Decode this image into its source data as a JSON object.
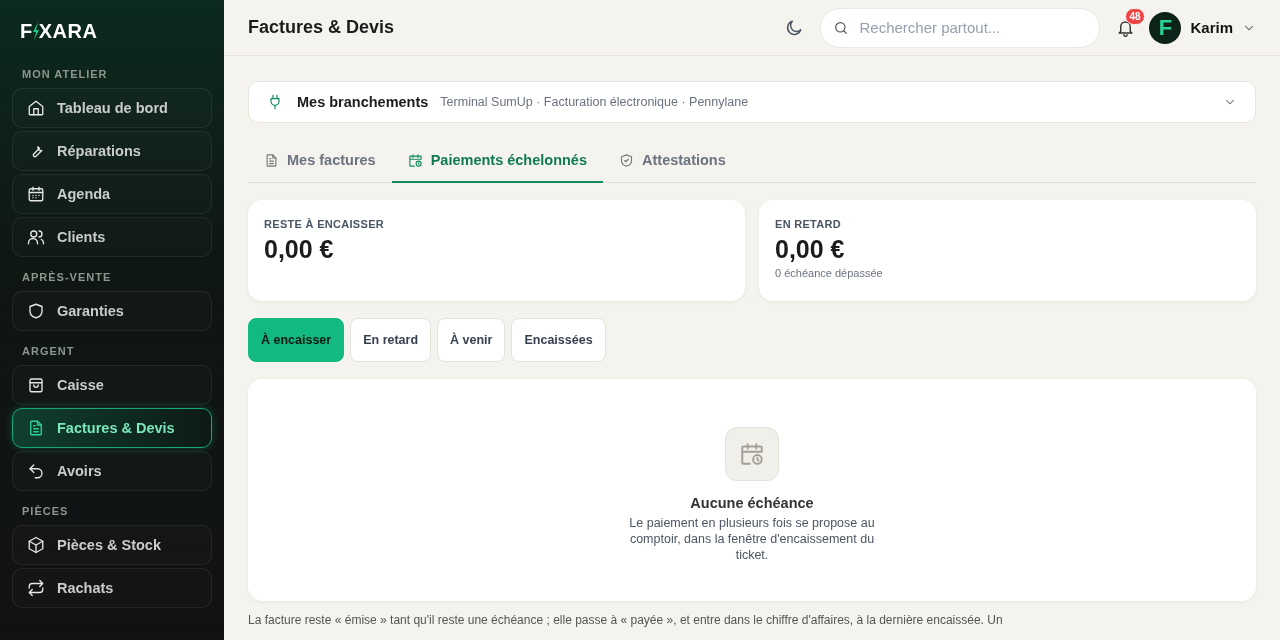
{
  "brand": {
    "lead": "F",
    "rest": "XARA"
  },
  "sidebar": {
    "sections": [
      {
        "title": "MON ATELIER",
        "items": [
          {
            "label": "Tableau de bord",
            "selected": false
          },
          {
            "label": "Réparations",
            "selected": false
          },
          {
            "label": "Agenda",
            "selected": false
          },
          {
            "label": "Clients",
            "selected": false
          }
        ]
      },
      {
        "title": "APRÈS-VENTE",
        "items": [
          {
            "label": "Garanties",
            "selected": false
          }
        ]
      },
      {
        "title": "ARGENT",
        "items": [
          {
            "label": "Caisse",
            "selected": false
          },
          {
            "label": "Factures & Devis",
            "selected": true
          },
          {
            "label": "Avoirs",
            "selected": false
          }
        ]
      },
      {
        "title": "PIÈCES",
        "items": [
          {
            "label": "Pièces & Stock",
            "selected": false
          },
          {
            "label": "Rachats",
            "selected": false
          }
        ]
      }
    ]
  },
  "topbar": {
    "title": "Factures & Devis",
    "search": {
      "placeholder": "Rechercher partout..."
    },
    "notifications": "48",
    "user": {
      "initial": "F",
      "name": "Karim"
    }
  },
  "connections": {
    "title": "Mes branchements",
    "summary": "Terminal SumUp · Facturation électronique · Pennylane",
    "expanded": false
  },
  "tabs": [
    {
      "label": "Mes factures",
      "selected": false
    },
    {
      "label": "Paiements échelonnés",
      "selected": true
    },
    {
      "label": "Attestations",
      "selected": false
    }
  ],
  "stats": [
    {
      "label": "RESTE À ENCAISSER",
      "value": "0,00 €"
    },
    {
      "label": "EN RETARD",
      "value": "0,00 €",
      "note": "0 échéance dépassée"
    }
  ],
  "filters": [
    {
      "label": "À encaisser",
      "selected": true
    },
    {
      "label": "En retard",
      "selected": false
    },
    {
      "label": "À venir",
      "selected": false
    },
    {
      "label": "Encaissées",
      "selected": false
    }
  ],
  "empty_state": {
    "title": "Aucune échéance",
    "text": "Le paiement en plusieurs fois se propose au comptoir, dans la fenêtre d'encaissement du ticket."
  },
  "footnote": "La facture reste « émise » tant qu'il reste une échéance ; elle passe à « payée », et entre dans le chiffre d'affaires, à la dernière encaissée. Un"
}
